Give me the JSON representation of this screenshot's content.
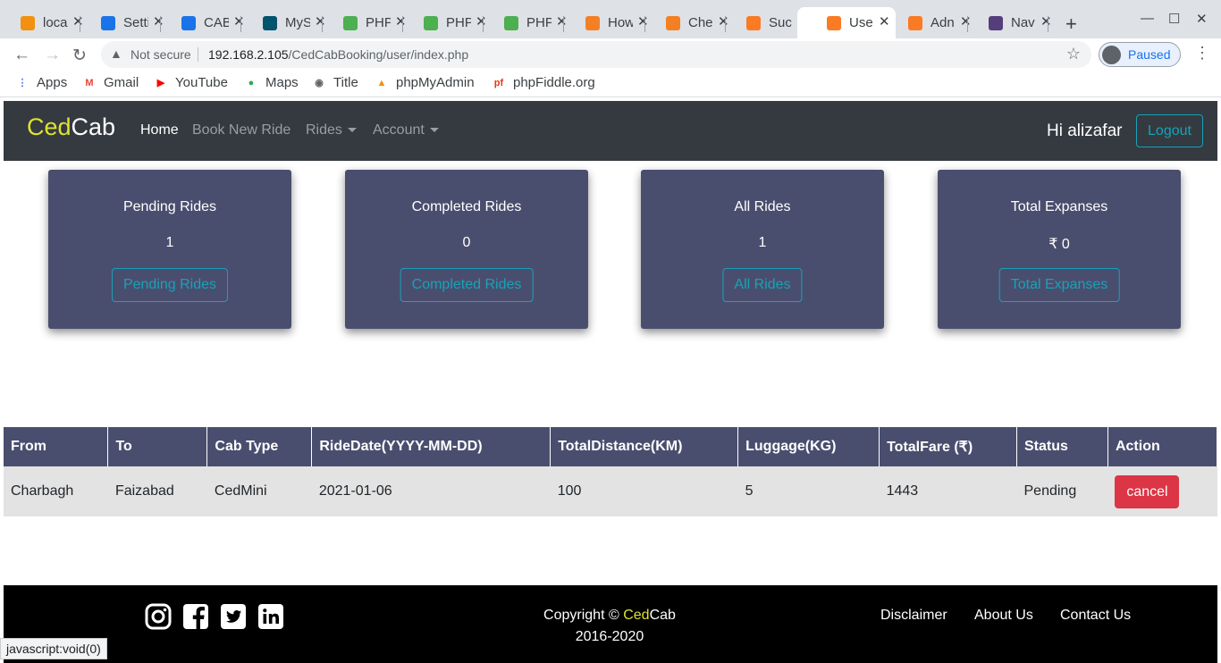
{
  "browser": {
    "tabs": [
      {
        "label": "loca",
        "icon": "phpmyadmin-icon",
        "color": "#f29111"
      },
      {
        "label": "Setti",
        "icon": "gear-icon",
        "color": "#1a73e8"
      },
      {
        "label": "CAB",
        "icon": "contacts-icon",
        "color": "#1a73e8"
      },
      {
        "label": "MyS",
        "icon": "mysql-icon",
        "color": "#00546b"
      },
      {
        "label": "PHP",
        "icon": "w3schools-icon",
        "color": "#4caf50"
      },
      {
        "label": "PHP",
        "icon": "w3schools-icon",
        "color": "#4caf50"
      },
      {
        "label": "PHP",
        "icon": "w3schools-icon",
        "color": "#4caf50"
      },
      {
        "label": "How",
        "icon": "stackoverflow-icon",
        "color": "#f48024"
      },
      {
        "label": "Che",
        "icon": "stackoverflow-icon",
        "color": "#f48024"
      },
      {
        "label": "Suc",
        "icon": "xampp-icon",
        "color": "#fb7a24"
      },
      {
        "label": "Use",
        "icon": "xampp-icon",
        "color": "#fb7a24"
      },
      {
        "label": "Adn",
        "icon": "xampp-icon",
        "color": "#fb7a24"
      },
      {
        "label": "Nav",
        "icon": "bootstrap-icon",
        "color": "#563d7c"
      }
    ],
    "active_tab": 10,
    "not_secure": "Not secure",
    "url_host": "192.168.2.105",
    "url_path": "/CedCabBooking/user/index.php",
    "profile_status": "Paused",
    "bookmarks": [
      {
        "label": "Apps",
        "icon": "apps-grid-icon"
      },
      {
        "label": "Gmail",
        "icon": "gmail-icon"
      },
      {
        "label": "YouTube",
        "icon": "youtube-icon"
      },
      {
        "label": "Maps",
        "icon": "maps-pin-icon"
      },
      {
        "label": "Title",
        "icon": "globe-icon"
      },
      {
        "label": "phpMyAdmin",
        "icon": "phpmyadmin-icon"
      },
      {
        "label": "phpFiddle.org",
        "icon": "phpfiddle-icon"
      }
    ],
    "status_url": "javascript:void(0)"
  },
  "nav": {
    "brand_a": "Ced",
    "brand_b": "Cab",
    "home": "Home",
    "book": "Book New Ride",
    "rides": "Rides",
    "account": "Account",
    "greeting": "Hi alizafar",
    "logout": "Logout"
  },
  "cards": [
    {
      "title": "Pending Rides",
      "value": "1",
      "button": "Pending Rides"
    },
    {
      "title": "Completed Rides",
      "value": "0",
      "button": "Completed Rides"
    },
    {
      "title": "All Rides",
      "value": "1",
      "button": "All Rides"
    },
    {
      "title": "Total Expanses",
      "value": "₹ 0",
      "button": "Total Expanses"
    }
  ],
  "table": {
    "headers": [
      "From",
      "To",
      "Cab Type",
      "RideDate(YYYY-MM-DD)",
      "TotalDistance(KM)",
      "Luggage(KG)",
      "TotalFare (₹)",
      "Status",
      "Action"
    ],
    "rows": [
      {
        "from": "Charbagh",
        "to": "Faizabad",
        "cab": "CedMini",
        "date": "2021-01-06",
        "distance": "100",
        "luggage": "5",
        "fare": "1443",
        "status": "Pending",
        "action": "cancel"
      }
    ]
  },
  "footer": {
    "copyright_prefix": "Copyright ©",
    "brand_a": "Ced",
    "brand_b": "Cab",
    "years": "2016-2020",
    "links": [
      "Disclaimer",
      "About Us",
      "Contact Us"
    ],
    "social": [
      "instagram-icon",
      "facebook-icon",
      "twitter-icon",
      "linkedin-icon"
    ]
  },
  "colors": {
    "brand_yellow": "#dfe22e",
    "card_bg": "#4a4e6e",
    "accent": "#17a2b8",
    "danger": "#dc3545",
    "navbar": "#343a40"
  }
}
